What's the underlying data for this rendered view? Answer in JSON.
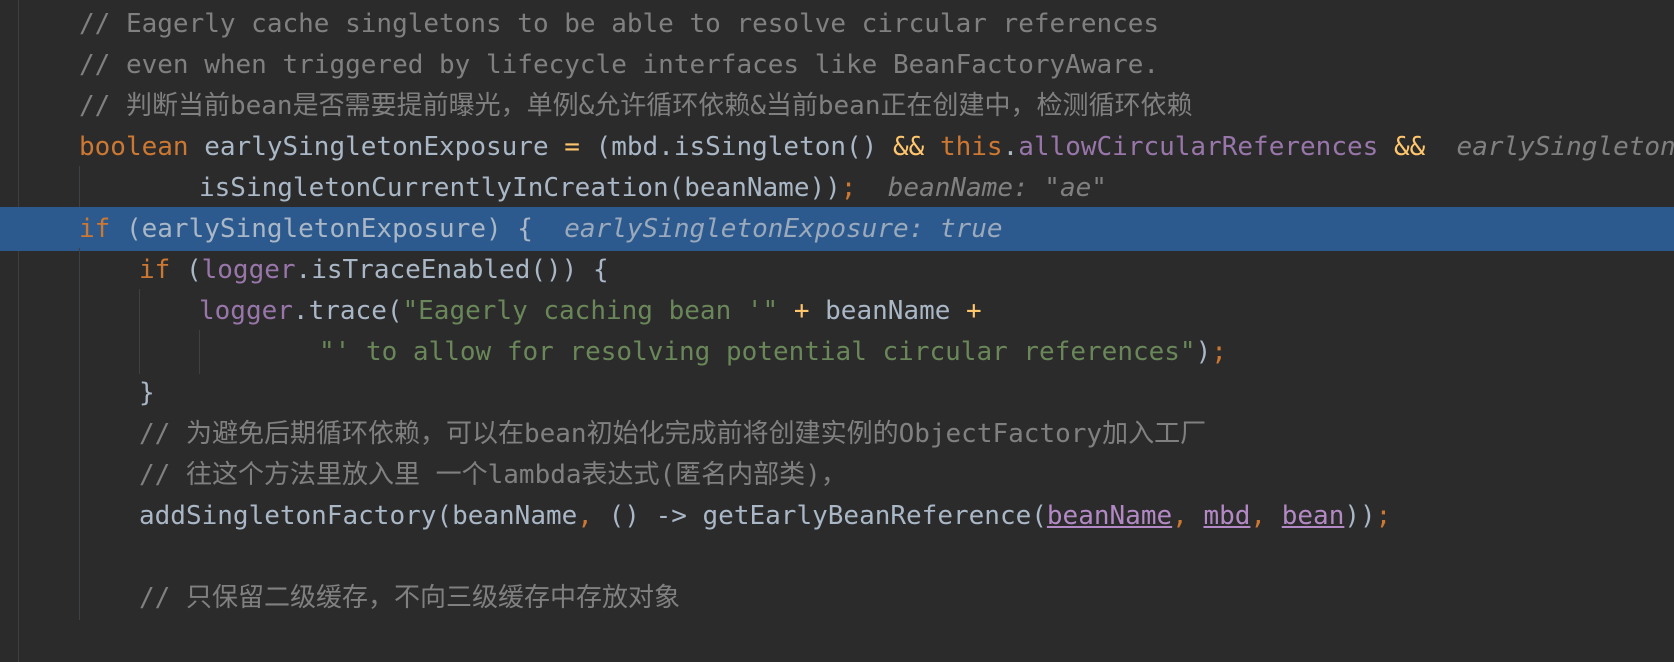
{
  "editor": {
    "lines": {
      "l1": {
        "comment": "// Eagerly cache singletons to be able to resolve circular references"
      },
      "l2": {
        "comment": "// even when triggered by lifecycle interfaces like BeanFactoryAware."
      },
      "l3": {
        "comment": "// 判断当前bean是否需要提前曝光，单例&允许循环依赖&当前bean正在创建中，检测循环依赖"
      },
      "l4": {
        "kw_boolean": "boolean",
        "var": " earlySingletonExposure ",
        "eq": "=",
        "open": " (mbd.isSingleton() ",
        "and1": "&&",
        "sp": " ",
        "kw_this": "this",
        "dot": ".",
        "field": "allowCircularReferences",
        "sp2": " ",
        "and2": "&&",
        "hint": "  earlySingletonExposure: true"
      },
      "l5": {
        "call": "isSingletonCurrentlyInCreation(beanName))",
        "semi": ";",
        "hint": "  beanName: \"ae\""
      },
      "l6": {
        "kw_if": "if",
        "rest": " (earlySingletonExposure) {",
        "hint": "  earlySingletonExposure: true"
      },
      "l7": {
        "kw_if": "if",
        "paren": " (",
        "logger": "logger",
        "rest": ".isTraceEnabled()) {"
      },
      "l8": {
        "logger": "logger",
        "call": ".trace(",
        "str": "\"Eagerly caching bean '\"",
        "plus1": " +",
        "name": " beanName",
        "plus2": " +"
      },
      "l9": {
        "str": "\"' to allow for resolving potential circular references\"",
        "close": ")",
        "semi": ";"
      },
      "l10": {
        "brace": "}"
      },
      "l11": {
        "comment": "// 为避免后期循环依赖，可以在bean初始化完成前将创建实例的ObjectFactory加入工厂"
      },
      "l12": {
        "comment": "// 往这个方法里放入里 一个lambda表达式(匿名内部类)，"
      },
      "l13": {
        "call": "addSingletonFactory(beanName",
        "comma1": ", ",
        "lambda": "() -> getEarlyBeanReference(",
        "arg1": "beanName",
        "comma2": ", ",
        "arg2": "mbd",
        "comma3": ", ",
        "arg3": "bean",
        "close": "))",
        "semi": ";"
      },
      "l15": {
        "comment": "// 只保留二级缓存，不向三级缓存中存放对象"
      }
    }
  },
  "colors": {
    "background": "#2b2b2b",
    "current_line": "#2d5a8e",
    "keyword": "#cc7832",
    "field": "#9876aa",
    "string": "#6a8759",
    "comment": "#808080"
  }
}
